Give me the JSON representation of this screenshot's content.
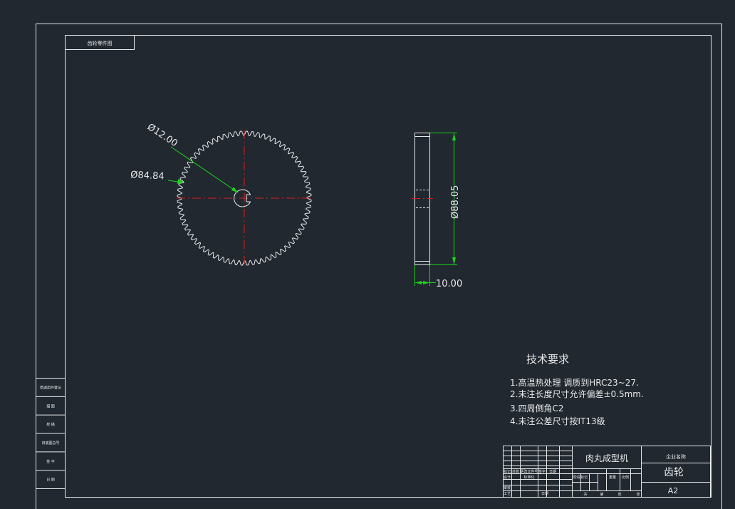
{
  "drawing": {
    "corner_label": "齿轮零件图",
    "gear_front": {
      "teeth": 72,
      "bore_diameter_label": "Ø12.00",
      "root_diameter_label": "Ø84.84"
    },
    "gear_side": {
      "outer_diameter_label": "Ø88.05",
      "width_label": "10.00"
    },
    "tech_requirements": {
      "heading": "技术要求",
      "items": [
        "1.高温热处理  调质到HRC23~27.",
        "2.未注长度尺寸允许偏差±0.5mm.",
        "3.四周倒角C2",
        "4.未注公差尺寸按IT13级"
      ]
    },
    "left_strip": {
      "cells": [
        "借通用件登记",
        "描    图",
        "校    描",
        "旧底图总号",
        "签    字",
        "日    期"
      ]
    },
    "title_block": {
      "project_name": "肉丸成型机",
      "company_label": "企业名称",
      "part_name": "齿轮",
      "sheet_size": "A2",
      "small_labels": [
        "标记",
        "处数",
        "更改文件号",
        "签字",
        "日期",
        "设计",
        "标准化",
        "审核",
        "工艺",
        "日期",
        "阶段标记",
        "重量",
        "比例",
        "共",
        "张",
        "第",
        "张"
      ]
    }
  },
  "colors": {
    "background": "#212830",
    "lines": "#e8e8e8",
    "dimension": "#19d619",
    "centerline": "#d92020"
  }
}
